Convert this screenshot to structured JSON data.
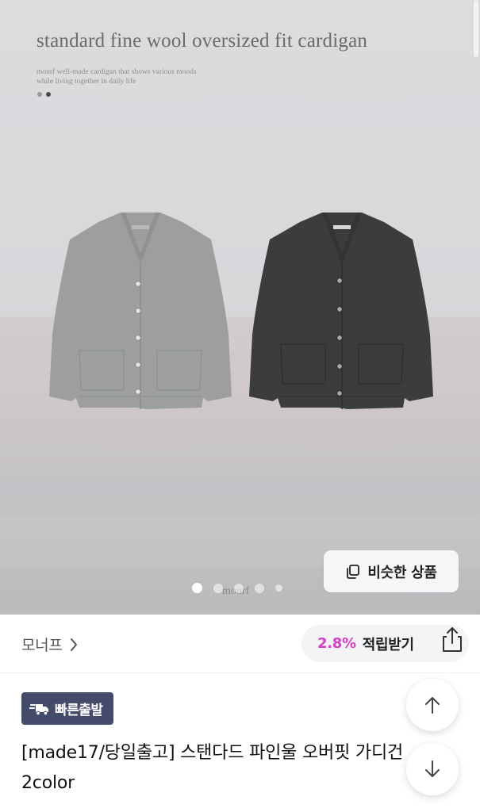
{
  "hero": {
    "title": "standard fine wool oversized fit cardigan",
    "subtitle": "monrf well-made cardigan that shows various moods while living together in daily life",
    "watermark": "monrf",
    "image_count": 5,
    "current_image": 1,
    "similar_button_label": "비슷한 상품",
    "colors": {
      "grey_cardigan": "#9c9f9c",
      "dark_cardigan": "#3b3c3d"
    }
  },
  "store": {
    "name": "모너프",
    "points_rate": "2.8%",
    "points_label": "적립받기"
  },
  "product": {
    "badge_label": "빠른출발",
    "title_line1": "[made17/당일출고] 스탠다드 파인울 오버핏 가디건",
    "title_line2": "2color"
  },
  "colors": {
    "badge_bg": "#434a6a",
    "points_accent": "#d63fc7"
  },
  "icons": {
    "similar": "copy-stack-icon",
    "store_chevron": "chevron-right-icon",
    "share": "share-icon",
    "badge": "fast-truck-icon",
    "scroll_up": "arrow-up-icon",
    "scroll_down": "arrow-down-icon"
  }
}
